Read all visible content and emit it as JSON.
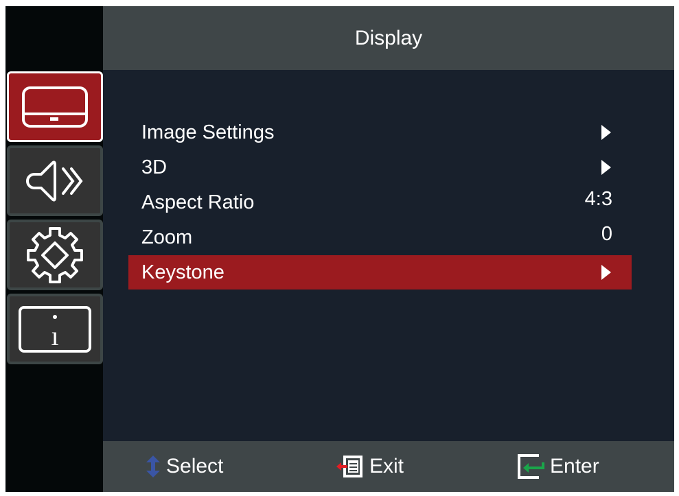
{
  "header": {
    "title": "Display"
  },
  "sidebar": {
    "items": [
      {
        "id": "display",
        "icon": "display-icon",
        "active": true
      },
      {
        "id": "audio",
        "icon": "speaker-icon",
        "active": false
      },
      {
        "id": "setup",
        "icon": "gear-icon",
        "active": false
      },
      {
        "id": "info",
        "icon": "info-icon",
        "active": false
      }
    ]
  },
  "menu": {
    "items": [
      {
        "label": "Image Settings",
        "value": "",
        "has_submenu": true,
        "selected": false
      },
      {
        "label": "3D",
        "value": "",
        "has_submenu": true,
        "selected": false
      },
      {
        "label": "Aspect Ratio",
        "value": "4:3",
        "has_submenu": false,
        "selected": false
      },
      {
        "label": "Zoom",
        "value": "0",
        "has_submenu": false,
        "selected": false
      },
      {
        "label": "Keystone",
        "value": "",
        "has_submenu": true,
        "selected": true
      }
    ]
  },
  "footer": {
    "select_label": "Select",
    "exit_label": "Exit",
    "enter_label": "Enter"
  },
  "colors": {
    "accent": "#9b1b1f",
    "header_bg": "#3f4648",
    "main_bg": "#18202c",
    "select_icon": "#3a55a5",
    "exit_arrow": "#e21d24",
    "enter_arrow": "#1aa64a"
  }
}
